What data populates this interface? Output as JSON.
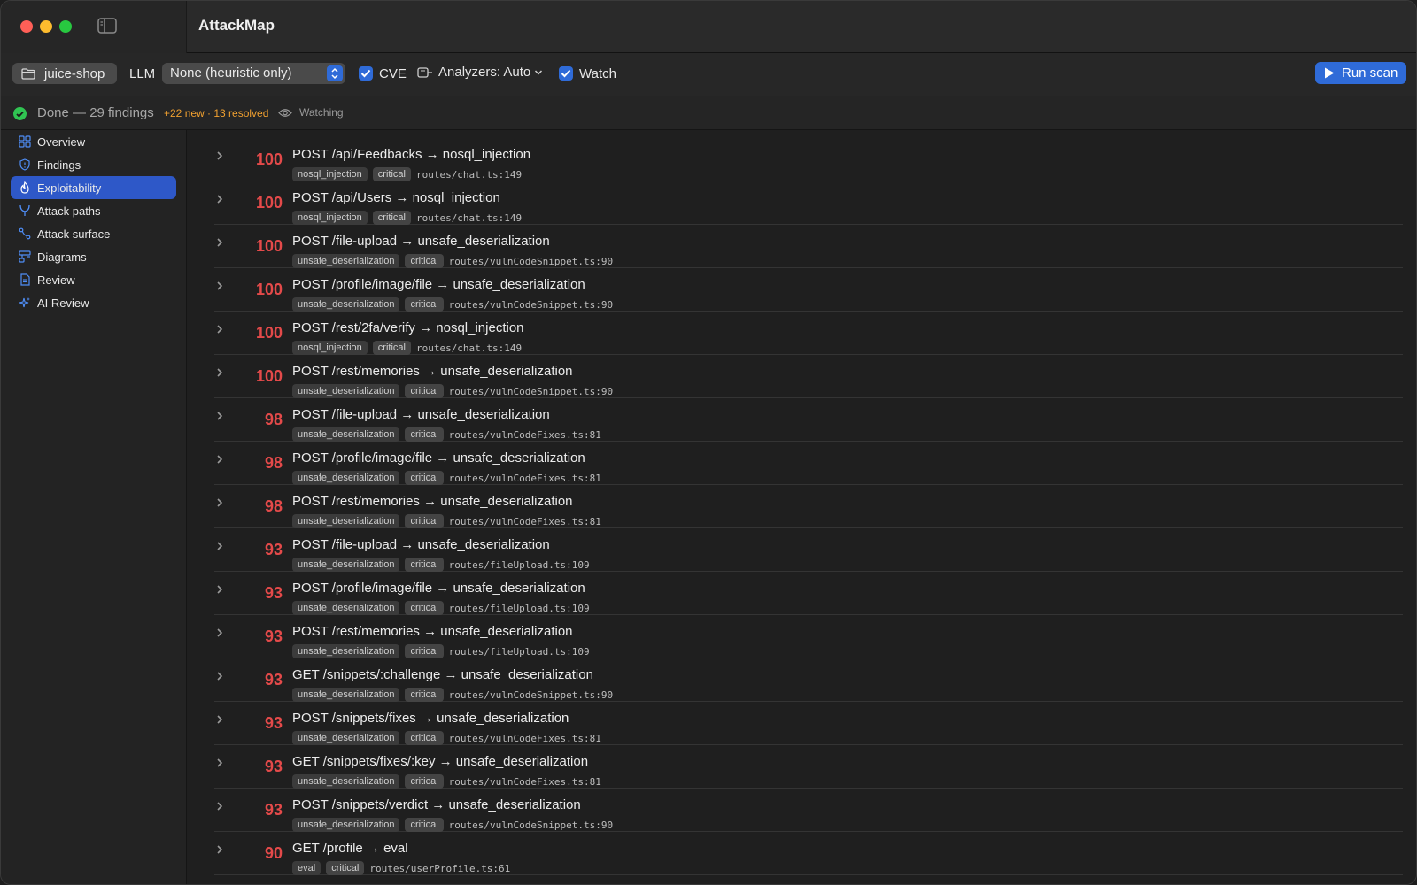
{
  "app": {
    "title": "AttackMap"
  },
  "toolbar": {
    "project": "juice-shop",
    "llm_label": "LLM",
    "llm_value": "None (heuristic only)",
    "cve_label": "CVE",
    "cve_checked": true,
    "analyzers_label": "Analyzers: Auto",
    "watch_label": "Watch",
    "watch_checked": true,
    "run_label": "Run scan"
  },
  "status": {
    "text": "Done — 29 findings",
    "delta": "+22 new · 13 resolved",
    "watching": "Watching"
  },
  "sidebar": {
    "items": [
      {
        "label": "Overview",
        "icon": "grid-icon",
        "active": false
      },
      {
        "label": "Findings",
        "icon": "shield-icon",
        "active": false
      },
      {
        "label": "Exploitability",
        "icon": "flame-icon",
        "active": true
      },
      {
        "label": "Attack paths",
        "icon": "branch-icon",
        "active": false
      },
      {
        "label": "Attack surface",
        "icon": "route-icon",
        "active": false
      },
      {
        "label": "Diagrams",
        "icon": "diagram-icon",
        "active": false
      },
      {
        "label": "Review",
        "icon": "document-icon",
        "active": false
      },
      {
        "label": "AI Review",
        "icon": "sparkles-icon",
        "active": false
      }
    ]
  },
  "findings": [
    {
      "score": "100",
      "title": "POST /api/Feedbacks → nosql_injection",
      "type": "nosql_injection",
      "severity": "critical",
      "location": "routes/chat.ts:149"
    },
    {
      "score": "100",
      "title": "POST /api/Users → nosql_injection",
      "type": "nosql_injection",
      "severity": "critical",
      "location": "routes/chat.ts:149"
    },
    {
      "score": "100",
      "title": "POST /file-upload → unsafe_deserialization",
      "type": "unsafe_deserialization",
      "severity": "critical",
      "location": "routes/vulnCodeSnippet.ts:90"
    },
    {
      "score": "100",
      "title": "POST /profile/image/file → unsafe_deserialization",
      "type": "unsafe_deserialization",
      "severity": "critical",
      "location": "routes/vulnCodeSnippet.ts:90"
    },
    {
      "score": "100",
      "title": "POST /rest/2fa/verify → nosql_injection",
      "type": "nosql_injection",
      "severity": "critical",
      "location": "routes/chat.ts:149"
    },
    {
      "score": "100",
      "title": "POST /rest/memories → unsafe_deserialization",
      "type": "unsafe_deserialization",
      "severity": "critical",
      "location": "routes/vulnCodeSnippet.ts:90"
    },
    {
      "score": "98",
      "title": "POST /file-upload → unsafe_deserialization",
      "type": "unsafe_deserialization",
      "severity": "critical",
      "location": "routes/vulnCodeFixes.ts:81"
    },
    {
      "score": "98",
      "title": "POST /profile/image/file → unsafe_deserialization",
      "type": "unsafe_deserialization",
      "severity": "critical",
      "location": "routes/vulnCodeFixes.ts:81"
    },
    {
      "score": "98",
      "title": "POST /rest/memories → unsafe_deserialization",
      "type": "unsafe_deserialization",
      "severity": "critical",
      "location": "routes/vulnCodeFixes.ts:81"
    },
    {
      "score": "93",
      "title": "POST /file-upload → unsafe_deserialization",
      "type": "unsafe_deserialization",
      "severity": "critical",
      "location": "routes/fileUpload.ts:109"
    },
    {
      "score": "93",
      "title": "POST /profile/image/file → unsafe_deserialization",
      "type": "unsafe_deserialization",
      "severity": "critical",
      "location": "routes/fileUpload.ts:109"
    },
    {
      "score": "93",
      "title": "POST /rest/memories → unsafe_deserialization",
      "type": "unsafe_deserialization",
      "severity": "critical",
      "location": "routes/fileUpload.ts:109"
    },
    {
      "score": "93",
      "title": "GET /snippets/:challenge → unsafe_deserialization",
      "type": "unsafe_deserialization",
      "severity": "critical",
      "location": "routes/vulnCodeSnippet.ts:90"
    },
    {
      "score": "93",
      "title": "POST /snippets/fixes → unsafe_deserialization",
      "type": "unsafe_deserialization",
      "severity": "critical",
      "location": "routes/vulnCodeFixes.ts:81"
    },
    {
      "score": "93",
      "title": "GET /snippets/fixes/:key → unsafe_deserialization",
      "type": "unsafe_deserialization",
      "severity": "critical",
      "location": "routes/vulnCodeFixes.ts:81"
    },
    {
      "score": "93",
      "title": "POST /snippets/verdict → unsafe_deserialization",
      "type": "unsafe_deserialization",
      "severity": "critical",
      "location": "routes/vulnCodeSnippet.ts:90"
    },
    {
      "score": "90",
      "title": "GET /profile → eval",
      "type": "eval",
      "severity": "critical",
      "location": "routes/userProfile.ts:61"
    }
  ],
  "colors": {
    "accent": "#2f6bd8",
    "score": "#e44a4a",
    "delta": "#f0a030",
    "ok": "#30c452"
  }
}
